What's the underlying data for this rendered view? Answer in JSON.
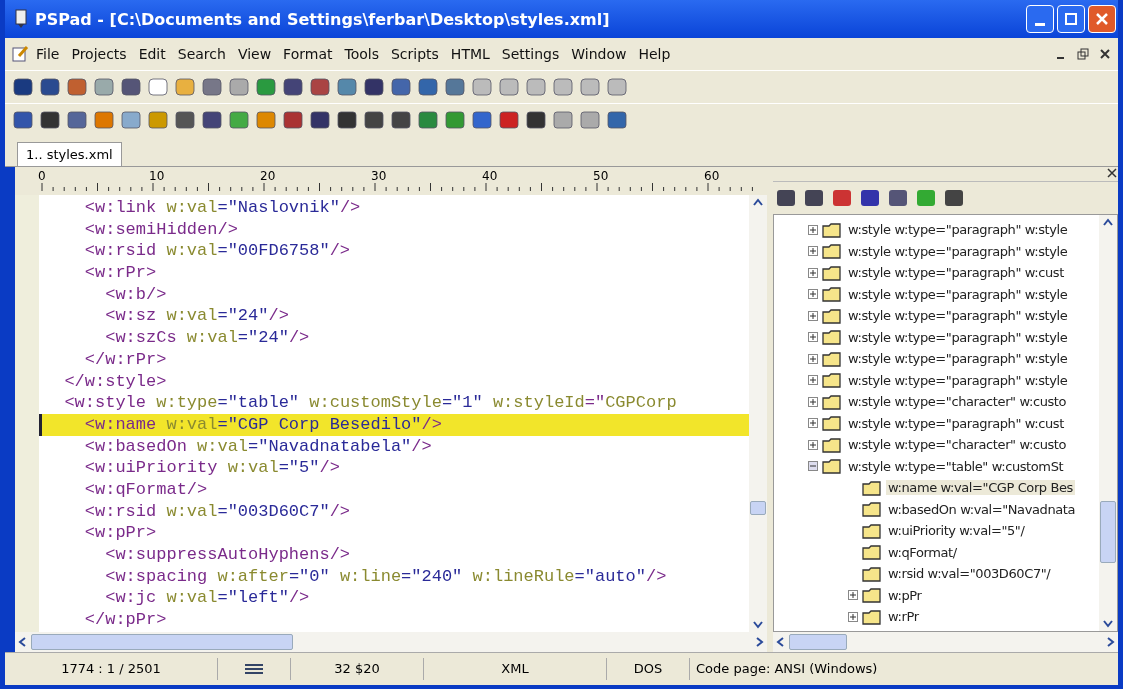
{
  "window": {
    "title": "PSPad - [C:\\Documents and Settings\\ferbar\\Desktop\\styles.xml]"
  },
  "menu": [
    "File",
    "Projects",
    "Edit",
    "Search",
    "View",
    "Format",
    "Tools",
    "Scripts",
    "HTML",
    "Settings",
    "Window",
    "Help"
  ],
  "tabs": [
    {
      "label": "1.. styles.xml",
      "selected": true
    }
  ],
  "ruler": {
    "labels": [
      "0",
      "10",
      "20",
      "30",
      "40",
      "50",
      "60"
    ]
  },
  "editor": {
    "lines": [
      {
        "text": "    <w:link w:val=\"Naslovnik\"/>",
        "highlighted": false
      },
      {
        "text": "    <w:semiHidden/>",
        "highlighted": false
      },
      {
        "text": "    <w:rsid w:val=\"00FD6758\"/>",
        "highlighted": false
      },
      {
        "text": "    <w:rPr>",
        "highlighted": false
      },
      {
        "text": "      <w:b/>",
        "highlighted": false
      },
      {
        "text": "      <w:sz w:val=\"24\"/>",
        "highlighted": false
      },
      {
        "text": "      <w:szCs w:val=\"24\"/>",
        "highlighted": false
      },
      {
        "text": "    </w:rPr>",
        "highlighted": false
      },
      {
        "text": "  </w:style>",
        "highlighted": false
      },
      {
        "text": "  <w:style w:type=\"table\" w:customStyle=\"1\" w:styleId=\"CGPCorp",
        "highlighted": false
      },
      {
        "text": "    <w:name w:val=\"CGP Corp Besedilo\"/>",
        "highlighted": true
      },
      {
        "text": "    <w:basedOn w:val=\"Navadnatabela\"/>",
        "highlighted": false
      },
      {
        "text": "    <w:uiPriority w:val=\"5\"/>",
        "highlighted": false
      },
      {
        "text": "    <w:qFormat/>",
        "highlighted": false
      },
      {
        "text": "    <w:rsid w:val=\"003D60C7\"/>",
        "highlighted": false
      },
      {
        "text": "    <w:pPr>",
        "highlighted": false
      },
      {
        "text": "      <w:suppressAutoHyphens/>",
        "highlighted": false
      },
      {
        "text": "      <w:spacing w:after=\"0\" w:line=\"240\" w:lineRule=\"auto\"/>",
        "highlighted": false
      },
      {
        "text": "      <w:jc w:val=\"left\"/>",
        "highlighted": false
      },
      {
        "text": "    </w:pPr>",
        "highlighted": false
      }
    ]
  },
  "tree": {
    "items": [
      {
        "label": "w:style w:type=\"paragraph\" w:style",
        "expanded": false,
        "selected": false
      },
      {
        "label": "w:style w:type=\"paragraph\" w:style",
        "expanded": false,
        "selected": false
      },
      {
        "label": "w:style w:type=\"paragraph\" w:cust",
        "expanded": false,
        "selected": false
      },
      {
        "label": "w:style w:type=\"paragraph\" w:style",
        "expanded": false,
        "selected": false
      },
      {
        "label": "w:style w:type=\"paragraph\" w:style",
        "expanded": false,
        "selected": false
      },
      {
        "label": "w:style w:type=\"paragraph\" w:style",
        "expanded": false,
        "selected": false
      },
      {
        "label": "w:style w:type=\"paragraph\" w:style",
        "expanded": false,
        "selected": false
      },
      {
        "label": "w:style w:type=\"paragraph\" w:style",
        "expanded": false,
        "selected": false
      },
      {
        "label": "w:style w:type=\"character\" w:custo",
        "expanded": false,
        "selected": false
      },
      {
        "label": "w:style w:type=\"paragraph\" w:cust",
        "expanded": false,
        "selected": false
      },
      {
        "label": "w:style w:type=\"character\" w:custo",
        "expanded": false,
        "selected": false
      },
      {
        "label": "w:style w:type=\"table\" w:customSt",
        "expanded": true,
        "selected": false,
        "children": [
          {
            "label": "w:name w:val=\"CGP Corp Bes",
            "selected": true
          },
          {
            "label": "w:basedOn w:val=\"Navadnata",
            "selected": false
          },
          {
            "label": "w:uiPriority w:val=\"5\"/",
            "selected": false
          },
          {
            "label": "w:qFormat/",
            "selected": false
          },
          {
            "label": "w:rsid w:val=\"003D60C7\"/",
            "selected": false
          },
          {
            "label": "w:pPr",
            "expanded": false,
            "selected": false
          },
          {
            "label": "w:rPr",
            "expanded": false,
            "selected": false
          }
        ]
      }
    ]
  },
  "status_bar": {
    "position": "1774 : 1 / 2501",
    "char": "32  $20",
    "syntax": "XML",
    "line_ending": "DOS",
    "code_page": "Code page: ANSI (Windows)"
  }
}
